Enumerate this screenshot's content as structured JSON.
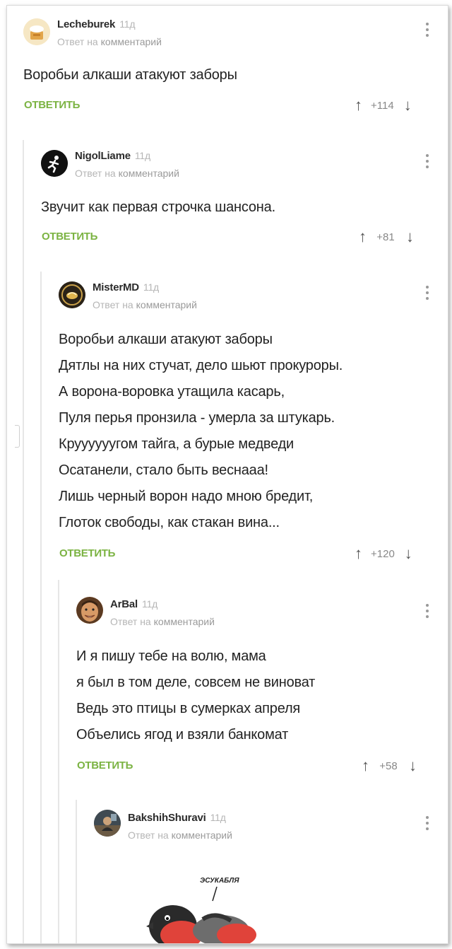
{
  "reply_prefix": "Ответ на",
  "reply_target": "комментарий",
  "reply_label": "ОТВЕТИТЬ",
  "comments": [
    {
      "user": "Lecheburek",
      "time": "11д",
      "text": "Воробьи алкаши атакуют заборы",
      "rating": "+114",
      "avatar_icon": "hat-avatar-icon"
    },
    {
      "user": "NigolLiame",
      "time": "11д",
      "text": "Звучит как первая строчка шансона.",
      "rating": "+81",
      "avatar_icon": "runner-avatar-icon"
    },
    {
      "user": "MisterMD",
      "time": "11д",
      "text_lines": [
        "Воробьи алкаши атакуют заборы",
        "Дятлы на них стучат, дело шьют прокуроры.",
        "А ворона-воровка утащила касарь,",
        "Пуля перья пронзила - умерла за штукарь.",
        "Круууууугом тайга, а бурые медведи",
        "Осатанели, стало быть веснааа!",
        "Лишь черный ворон надо мною бредит,",
        "Глоток свободы, как стакан вина..."
      ],
      "rating": "+120",
      "avatar_icon": "badge-avatar-icon"
    },
    {
      "user": "ArBal",
      "time": "11д",
      "text_lines": [
        "И я пишу тебе на волю, мама",
        "я был в том деле, совсем не виноват",
        "Ведь это птицы в сумерках апреля",
        "Объелись ягод и взяли банкомат"
      ],
      "rating": "+58",
      "avatar_icon": "face-avatar-icon"
    },
    {
      "user": "BakshihShuravi",
      "time": "11д",
      "avatar_icon": "photo-avatar-icon",
      "image_caption": "ЭСУКАБЛЯ"
    }
  ],
  "colors": {
    "accent": "#7bb342",
    "thread_line": "#e6e6e6",
    "muted": "#b5b5b5"
  }
}
